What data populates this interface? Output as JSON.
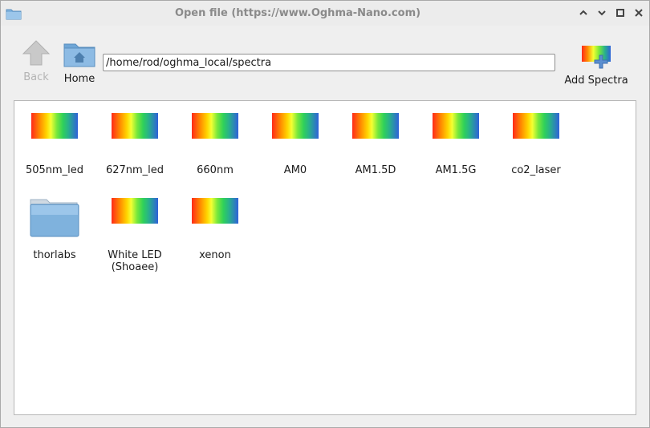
{
  "window": {
    "title": "Open file (https://www.Oghma-Nano.com)",
    "controls": [
      "chevron-up-icon",
      "chevron-down-icon",
      "maximize-icon",
      "close-icon"
    ]
  },
  "toolbar": {
    "back_label": "Back",
    "home_label": "Home",
    "add_spectra_label": "Add Spectra",
    "path_value": "/home/rod/oghma_local/spectra"
  },
  "files": [
    {
      "label": "505nm_led",
      "icon": "spectrum-icon"
    },
    {
      "label": "627nm_led",
      "icon": "spectrum-icon"
    },
    {
      "label": "660nm",
      "icon": "spectrum-icon"
    },
    {
      "label": "AM0",
      "icon": "spectrum-icon"
    },
    {
      "label": "AM1.5D",
      "icon": "spectrum-icon"
    },
    {
      "label": "AM1.5G",
      "icon": "spectrum-icon"
    },
    {
      "label": "co2_laser",
      "icon": "spectrum-icon"
    },
    {
      "label": "thorlabs",
      "icon": "folder-icon"
    },
    {
      "label": "White LED\n(Shoaee)",
      "icon": "spectrum-icon"
    },
    {
      "label": "xenon",
      "icon": "spectrum-icon"
    }
  ],
  "colors": {
    "spectrum_start": "#ff2a1a",
    "spectrum_end": "#2f62d9",
    "folder": "#7fb2dd"
  }
}
